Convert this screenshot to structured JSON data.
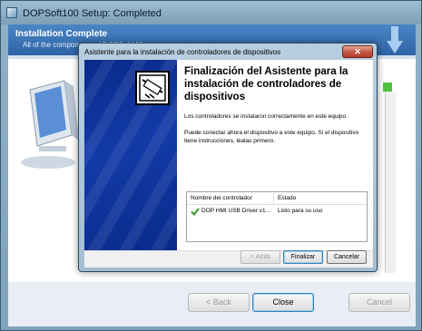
{
  "outer_window": {
    "title": "DOPSoft100 Setup: Completed",
    "header_title": "Installation Complete",
    "header_subtitle": "All of the components of DOPSoft100 ...",
    "buttons": {
      "back": "< Back",
      "close": "Close",
      "cancel": "Cancel"
    }
  },
  "dialog": {
    "title": "Asistente para la instalación de controladores de dispositivos",
    "close_glyph": "✕",
    "heading": "Finalización del Asistente para la instalación de controladores de dispositivos",
    "paragraph1": "Los controladores se instalaron correctamente en este equipo.",
    "paragraph2": "Puede conectar ahora el dispositivo a este equipo. Si el dispositivo tiene instrucciones, léalas primero.",
    "table": {
      "columns": [
        "Nombre del controlador",
        "Estado"
      ],
      "rows": [
        {
          "name": "DOP HMI USB Driver v1...",
          "status": "Listo para su uso",
          "icon": "checkmark-icon"
        }
      ]
    },
    "buttons": {
      "back": "< Atrás",
      "finish": "Finalizar",
      "cancel": "Cancelar"
    }
  },
  "colors": {
    "banner": "#123aa8",
    "header": "#2e63a6",
    "check": "#3a9a2a"
  }
}
